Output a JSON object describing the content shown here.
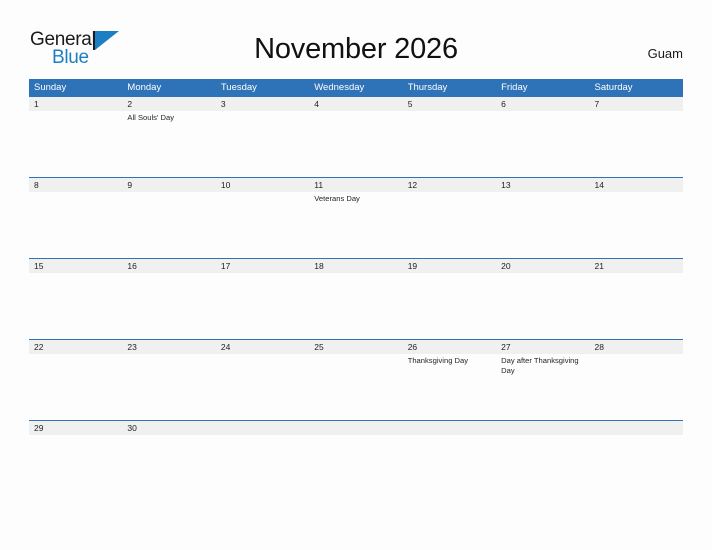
{
  "brand": {
    "name_part1": "General",
    "name_part2": "Blue",
    "accent_color": "#1d7fc3"
  },
  "header": {
    "title": "November 2026",
    "locale": "Guam",
    "header_color": "#2e72b8",
    "dateband_color": "#f0f0f0"
  },
  "calendar": {
    "month": "November",
    "year": "2026",
    "weekday_headers": [
      "Sunday",
      "Monday",
      "Tuesday",
      "Wednesday",
      "Thursday",
      "Friday",
      "Saturday"
    ],
    "weeks": [
      {
        "days": [
          {
            "num": "1",
            "event": ""
          },
          {
            "num": "2",
            "event": "All Souls' Day"
          },
          {
            "num": "3",
            "event": ""
          },
          {
            "num": "4",
            "event": ""
          },
          {
            "num": "5",
            "event": ""
          },
          {
            "num": "6",
            "event": ""
          },
          {
            "num": "7",
            "event": ""
          }
        ]
      },
      {
        "days": [
          {
            "num": "8",
            "event": ""
          },
          {
            "num": "9",
            "event": ""
          },
          {
            "num": "10",
            "event": ""
          },
          {
            "num": "11",
            "event": "Veterans Day"
          },
          {
            "num": "12",
            "event": ""
          },
          {
            "num": "13",
            "event": ""
          },
          {
            "num": "14",
            "event": ""
          }
        ]
      },
      {
        "days": [
          {
            "num": "15",
            "event": ""
          },
          {
            "num": "16",
            "event": ""
          },
          {
            "num": "17",
            "event": ""
          },
          {
            "num": "18",
            "event": ""
          },
          {
            "num": "19",
            "event": ""
          },
          {
            "num": "20",
            "event": ""
          },
          {
            "num": "21",
            "event": ""
          }
        ]
      },
      {
        "days": [
          {
            "num": "22",
            "event": ""
          },
          {
            "num": "23",
            "event": ""
          },
          {
            "num": "24",
            "event": ""
          },
          {
            "num": "25",
            "event": ""
          },
          {
            "num": "26",
            "event": "Thanksgiving Day"
          },
          {
            "num": "27",
            "event": "Day after Thanksgiving Day"
          },
          {
            "num": "28",
            "event": ""
          }
        ]
      },
      {
        "days": [
          {
            "num": "29",
            "event": ""
          },
          {
            "num": "30",
            "event": ""
          },
          {
            "num": "",
            "event": ""
          },
          {
            "num": "",
            "event": ""
          },
          {
            "num": "",
            "event": ""
          },
          {
            "num": "",
            "event": ""
          },
          {
            "num": "",
            "event": ""
          }
        ]
      }
    ]
  }
}
